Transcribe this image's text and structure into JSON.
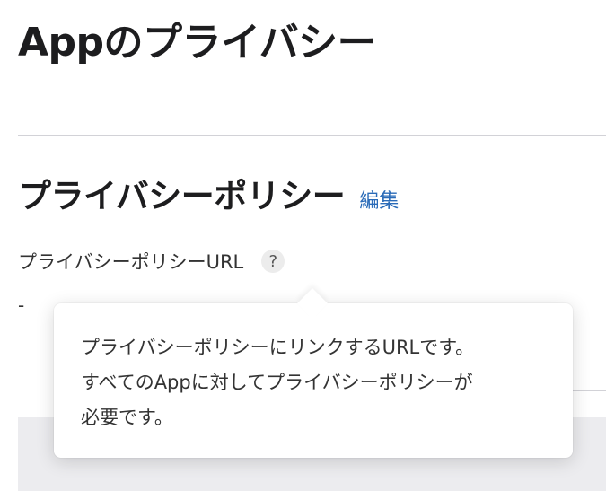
{
  "page": {
    "title": "Appのプライバシー"
  },
  "privacy_policy_section": {
    "title": "プライバシーポリシー",
    "edit_label": "編集",
    "field": {
      "label": "プライバシーポリシーURL",
      "help_symbol": "?",
      "value": "-"
    }
  },
  "tooltip": {
    "lines": [
      "プライバシーポリシーにリンクするURLです。",
      "すべてのAppに対してプライバシーポリシーが",
      "必要です。"
    ]
  },
  "colors": {
    "link": "#2a6bb8",
    "divider": "#d2d2d7",
    "band": "#ececef"
  }
}
